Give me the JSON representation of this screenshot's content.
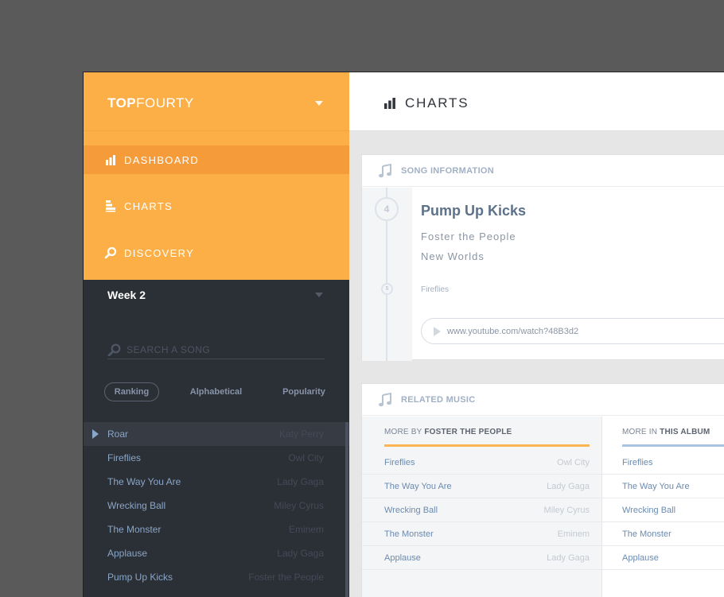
{
  "brand": {
    "bold": "TOP",
    "light": "FOURTY"
  },
  "nav": [
    {
      "label": "DASHBOARD",
      "icon": "bar-chart-icon",
      "active": true
    },
    {
      "label": "CHARTS",
      "icon": "charts-icon",
      "active": false
    },
    {
      "label": "DISCOVERY",
      "icon": "search-icon",
      "active": false
    }
  ],
  "week": {
    "label": "Week 2"
  },
  "search": {
    "placeholder": "SEARCH A SONG"
  },
  "sort": {
    "ranking": "Ranking",
    "alphabetical": "Alphabetical",
    "popularity": "Popularity",
    "selected": "Ranking"
  },
  "songs": [
    {
      "title": "Roar",
      "artist": "Katy Perry"
    },
    {
      "title": "Fireflies",
      "artist": "Owl City"
    },
    {
      "title": "The Way You Are",
      "artist": "Lady Gaga"
    },
    {
      "title": "Wrecking Ball",
      "artist": "Miley Cyrus"
    },
    {
      "title": "The Monster",
      "artist": "Eminem"
    },
    {
      "title": "Applause",
      "artist": "Lady Gaga"
    },
    {
      "title": "Pump Up Kicks",
      "artist": "Foster the People"
    }
  ],
  "header": {
    "title": "CHARTS",
    "icon": "bar-chart-icon"
  },
  "song_info": {
    "heading": "SONG INFORMATION",
    "rank": "4",
    "next_rank": "5",
    "title": "Pump Up Kicks",
    "artist": "Foster the People",
    "album": "New Worlds",
    "next_song": "Fireflies",
    "link": "www.youtube.com/watch?48B3d2"
  },
  "related": {
    "heading": "RELATED MUSIC",
    "more_by_prefix": "MORE BY ",
    "more_by_artist": "FOSTER THE PEOPLE",
    "more_in_prefix": "MORE IN ",
    "more_in_album": "THIS ALBUM",
    "more_by": [
      {
        "title": "Fireflies",
        "artist": "Owl City"
      },
      {
        "title": "The Way You Are",
        "artist": "Lady Gaga"
      },
      {
        "title": "Wrecking Ball",
        "artist": "Miley Cyrus"
      },
      {
        "title": "The Monster",
        "artist": "Eminem"
      },
      {
        "title": "Applause",
        "artist": "Lady Gaga"
      }
    ],
    "more_in": [
      {
        "title": "Fireflies"
      },
      {
        "title": "The Way You Are"
      },
      {
        "title": "Wrecking Ball"
      },
      {
        "title": "The Monster"
      },
      {
        "title": "Applause"
      }
    ]
  },
  "colors": {
    "accent_orange": "#fdaf47",
    "active_orange": "#f59b3a",
    "sidebar_dark": "#2b2f36",
    "link_blue": "#6b8bb0"
  }
}
